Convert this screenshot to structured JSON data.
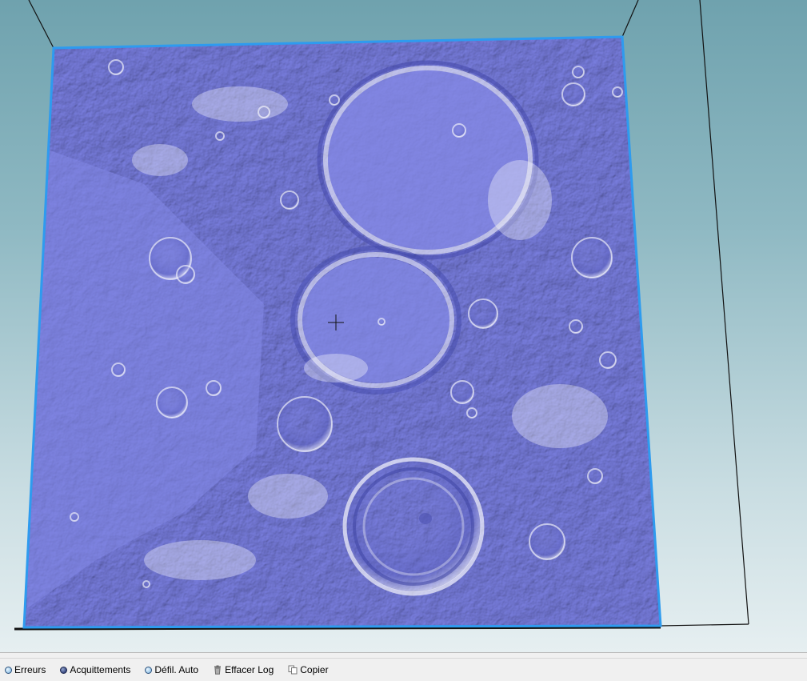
{
  "scene": {
    "description_icon": "3d-terrain-viewport",
    "terrain_color": "#7a7fe0",
    "selection_outline_color": "#2e9bef",
    "frame_line_color": "#111111",
    "background_top": "#6fa2ae",
    "background_bottom": "#e6eff1",
    "cursor_icon": "crosshair-icon"
  },
  "toolbar": {
    "errors_label": "Erreurs",
    "acks_label": "Acquittements",
    "autoscroll_label": "Défil. Auto",
    "clear_log_label": "Effacer Log",
    "copy_label": "Copier",
    "acks_selected": true
  }
}
